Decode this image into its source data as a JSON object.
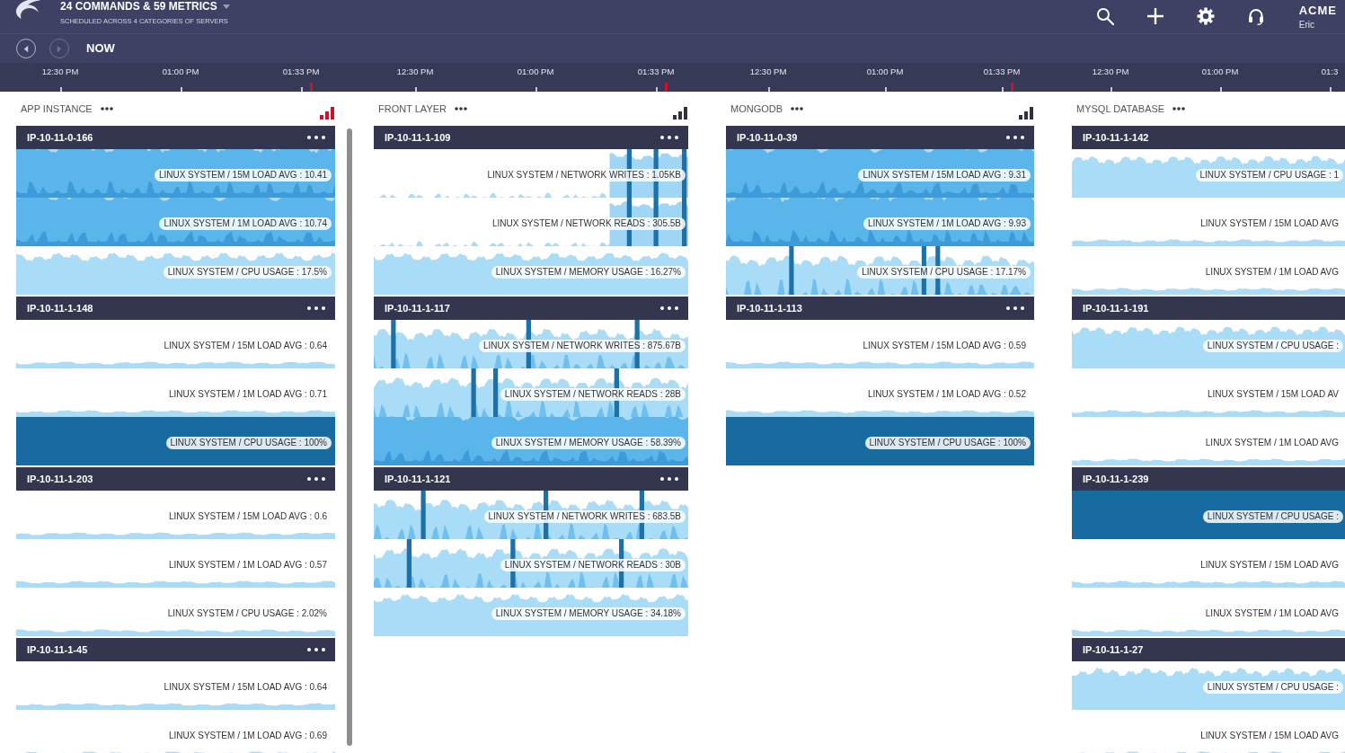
{
  "header": {
    "title": "24 COMMANDS & 59 METRICS",
    "subtitle": "SCHEDULED ACROSS 4 CATEGORIES OF SERVERS",
    "org": "ACME",
    "user": "Eric"
  },
  "time_nav": {
    "buttons": [
      {
        "kind": "back",
        "disabled": false
      },
      {
        "kind": "forward",
        "disabled": true
      }
    ],
    "label": "NOW"
  },
  "columns": [
    {
      "title": "APP INSTANCE",
      "signal": {
        "color": "#d0112b"
      },
      "timeline": [
        {
          "label": "12:30 PM",
          "now": false
        },
        {
          "label": "01:00 PM",
          "now": false
        },
        {
          "label": "01:33 PM",
          "now": true
        }
      ],
      "scrollable": true,
      "servers": [
        {
          "name": "IP-10-11-0-166",
          "menu": true,
          "metrics": [
            {
              "label": "LINUX SYSTEM / 15M LOAD AVG : 10.41",
              "kind": "high"
            },
            {
              "label": "LINUX SYSTEM / 1M LOAD AVG : 10.74",
              "kind": "high"
            },
            {
              "label": "LINUX SYSTEM / CPU USAGE : 17.5%",
              "kind": "medium"
            }
          ]
        },
        {
          "name": "IP-10-11-1-148",
          "menu": true,
          "metrics": [
            {
              "label": "LINUX SYSTEM / 15M LOAD AVG : 0.64",
              "kind": "low"
            },
            {
              "label": "LINUX SYSTEM / 1M LOAD AVG : 0.71",
              "kind": "low"
            },
            {
              "label": "LINUX SYSTEM / CPU USAGE : 100%",
              "kind": "full"
            }
          ]
        },
        {
          "name": "IP-10-11-1-203",
          "menu": true,
          "metrics": [
            {
              "label": "LINUX SYSTEM / 15M LOAD AVG : 0.6",
              "kind": "low"
            },
            {
              "label": "LINUX SYSTEM / 1M LOAD AVG : 0.57",
              "kind": "low"
            },
            {
              "label": "LINUX SYSTEM / CPU USAGE : 2.02%",
              "kind": "low"
            }
          ]
        },
        {
          "name": "IP-10-11-1-45",
          "menu": true,
          "metrics": [
            {
              "label": "LINUX SYSTEM / 15M LOAD AVG : 0.64",
              "kind": "low"
            },
            {
              "label": "LINUX SYSTEM / 1M LOAD AVG : 0.69",
              "kind": "low"
            }
          ]
        }
      ]
    },
    {
      "title": "FRONT LAYER",
      "signal": {
        "color": "#2f3142"
      },
      "timeline": [
        {
          "label": "12:30 PM",
          "now": false
        },
        {
          "label": "01:00 PM",
          "now": false
        },
        {
          "label": "01:33 PM",
          "now": true
        }
      ],
      "servers": [
        {
          "name": "IP-10-11-1-109",
          "menu": true,
          "metrics": [
            {
              "label": "LINUX SYSTEM / NETWORK WRITES : 1.05KB",
              "kind": "traffic"
            },
            {
              "label": "LINUX SYSTEM / NETWORK READS : 305.5B",
              "kind": "traffic"
            },
            {
              "label": "LINUX SYSTEM / MEMORY USAGE : 16.27%",
              "kind": "medium"
            }
          ]
        },
        {
          "name": "IP-10-11-1-117",
          "menu": true,
          "metrics": [
            {
              "label": "LINUX SYSTEM / NETWORK WRITES : 875.67B",
              "kind": "spiky"
            },
            {
              "label": "LINUX SYSTEM / NETWORK READS : 28B",
              "kind": "spiky"
            },
            {
              "label": "LINUX SYSTEM / MEMORY USAGE : 58.39%",
              "kind": "high"
            }
          ]
        },
        {
          "name": "IP-10-11-1-121",
          "menu": true,
          "metrics": [
            {
              "label": "LINUX SYSTEM / NETWORK WRITES : 683.5B",
              "kind": "spiky"
            },
            {
              "label": "LINUX SYSTEM / NETWORK READS : 30B",
              "kind": "spiky"
            },
            {
              "label": "LINUX SYSTEM / MEMORY USAGE : 34.18%",
              "kind": "medium"
            }
          ]
        }
      ]
    },
    {
      "title": "MONGODB",
      "signal": {
        "color": "#2f3142"
      },
      "timeline": [
        {
          "label": "12:30 PM",
          "now": false
        },
        {
          "label": "01:00 PM",
          "now": false
        },
        {
          "label": "01:33 PM",
          "now": true
        }
      ],
      "servers": [
        {
          "name": "IP-10-11-0-39",
          "menu": true,
          "metrics": [
            {
              "label": "LINUX SYSTEM / 15M LOAD AVG : 9.31",
              "kind": "high"
            },
            {
              "label": "LINUX SYSTEM / 1M LOAD AVG : 9.93",
              "kind": "high"
            },
            {
              "label": "LINUX SYSTEM / CPU USAGE : 17.17%",
              "kind": "spiky"
            }
          ]
        },
        {
          "name": "IP-10-11-1-113",
          "menu": true,
          "metrics": [
            {
              "label": "LINUX SYSTEM / 15M LOAD AVG : 0.59",
              "kind": "low"
            },
            {
              "label": "LINUX SYSTEM / 1M LOAD AVG : 0.52",
              "kind": "low"
            },
            {
              "label": "LINUX SYSTEM / CPU USAGE : 100%",
              "kind": "full"
            }
          ]
        }
      ]
    },
    {
      "title": "MYSQL DATABASE",
      "timeline": [
        {
          "label": "12:30 PM",
          "now": false
        },
        {
          "label": "01:00 PM",
          "now": false
        },
        {
          "label": "01:3",
          "now": false
        }
      ],
      "servers": [
        {
          "name": "IP-10-11-1-142",
          "metrics": [
            {
              "label": "LINUX SYSTEM / CPU USAGE : 1",
              "kind": "medium"
            },
            {
              "label": "LINUX SYSTEM / 15M LOAD AVG",
              "kind": "low"
            },
            {
              "label": "LINUX SYSTEM / 1M LOAD AVG",
              "kind": "low"
            }
          ]
        },
        {
          "name": "IP-10-11-1-191",
          "metrics": [
            {
              "label": "LINUX SYSTEM / CPU USAGE :",
              "kind": "medium"
            },
            {
              "label": "LINUX SYSTEM / 15M LOAD AV",
              "kind": "low"
            },
            {
              "label": "LINUX SYSTEM / 1M LOAD AVG",
              "kind": "low"
            }
          ]
        },
        {
          "name": "IP-10-11-1-239",
          "metrics": [
            {
              "label": "LINUX SYSTEM / CPU USAGE :",
              "kind": "full"
            },
            {
              "label": "LINUX SYSTEM / 15M LOAD AVG",
              "kind": "low"
            },
            {
              "label": "LINUX SYSTEM / 1M LOAD AVG",
              "kind": "low"
            }
          ]
        },
        {
          "name": "IP-10-11-1-27",
          "metrics": [
            {
              "label": "LINUX SYSTEM / CPU USAGE :",
              "kind": "medium"
            },
            {
              "label": "LINUX SYSTEM / 15M LOAD AVG",
              "kind": "low"
            }
          ]
        }
      ]
    }
  ]
}
